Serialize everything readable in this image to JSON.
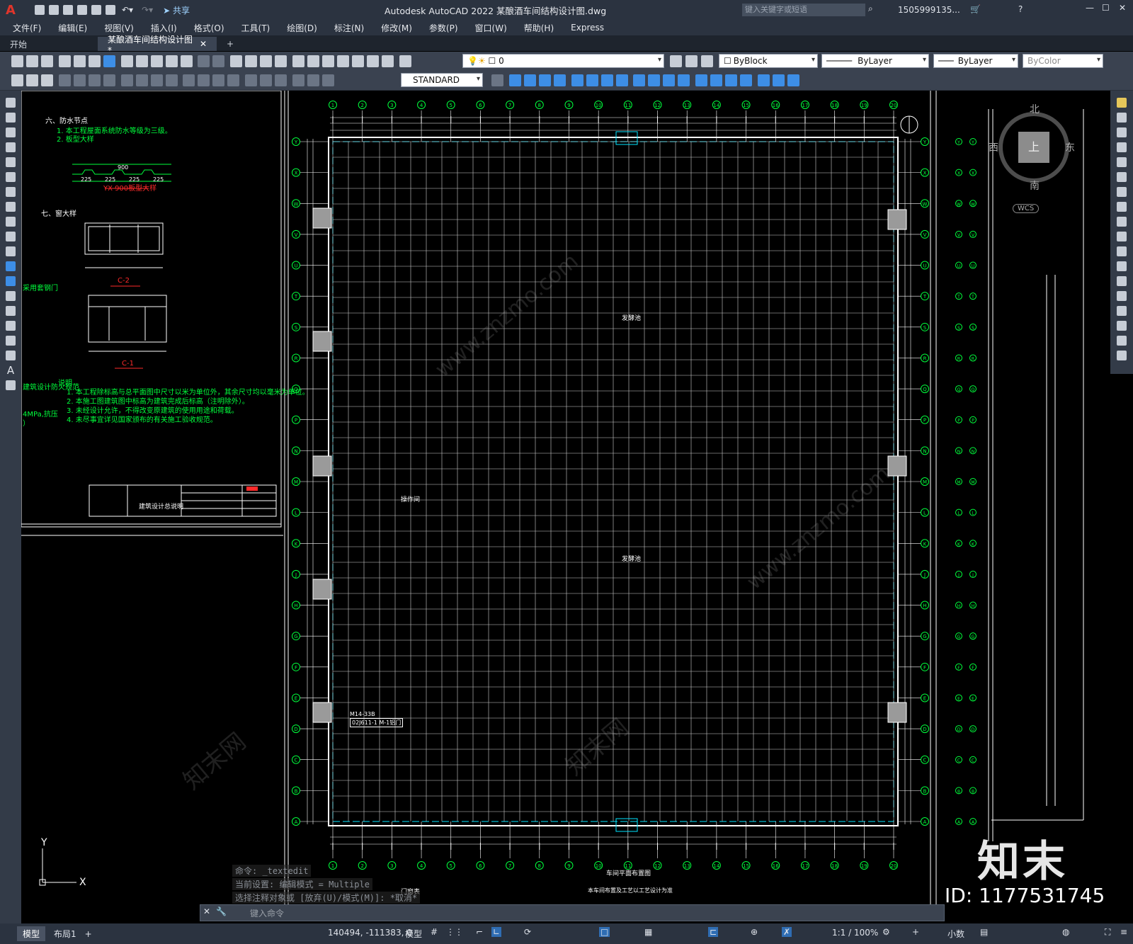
{
  "app": {
    "title": "Autodesk AutoCAD 2022    某酿酒车间结构设计图.dwg",
    "share_label": "共享",
    "search_placeholder": "键入关键字或短语",
    "user": "1505999135...",
    "logo": "A"
  },
  "menu": [
    "文件(F)",
    "编辑(E)",
    "视图(V)",
    "插入(I)",
    "格式(O)",
    "工具(T)",
    "绘图(D)",
    "标注(N)",
    "修改(M)",
    "参数(P)",
    "窗口(W)",
    "帮助(H)",
    "Express"
  ],
  "tabs": [
    {
      "label": "开始",
      "active": false
    },
    {
      "label": "某酿酒车间结构设计图*",
      "active": true
    }
  ],
  "toolbar": {
    "layer": "0",
    "color": "ByBlock",
    "linetype": "ByLayer",
    "lineweight": "ByLayer",
    "plotstyle": "ByColor",
    "textstyle": "STANDARD"
  },
  "drawing_notes": {
    "sec6_title": "六、防水节点",
    "sec6_lines": [
      "1. 本工程屋面系统防水等级为三级。",
      "2. 板型大样"
    ],
    "panel_caption": "YX-900板型大样",
    "panel_dims": [
      "900",
      "225",
      "225",
      "225",
      "225"
    ],
    "sec7_title": "七、窗大样",
    "window_labels": [
      "C-2",
      "C-1"
    ],
    "side_note": "采用套钢门",
    "notes_title": "说明",
    "notes_lines": [
      "1. 本工程除标高与总平面图中尺寸以米为单位外，其余尺寸均以毫米为单位。",
      "2. 本施工图建筑图中标高为建筑完成后标高（注明除外）。",
      "3. 未经设计允许，不得改变原建筑的使用用途和荷载。",
      "4. 未尽事宜详见国家颁布的有关施工验收规范。"
    ],
    "left_fragments": [
      "建筑设计防火规范",
      "4MPa,抗压",
      "）"
    ],
    "titleblock": "建筑设计总说明",
    "door_labels": [
      "M14-33B",
      "02J611-1 M-1铝门"
    ],
    "room_labels": [
      "发酵池",
      "操作间",
      "发酵池"
    ],
    "plan_title": "车间平面布置图",
    "plan_subtitle": "本车间布置及工艺以工艺设计为准",
    "bottom_caption": "门窗表"
  },
  "grid_cols": [
    "1",
    "2",
    "3",
    "4",
    "5",
    "6",
    "7",
    "8",
    "9",
    "10",
    "11",
    "12",
    "13",
    "14",
    "15",
    "16",
    "17",
    "18",
    "19",
    "20"
  ],
  "grid_rows": [
    "Y",
    "X",
    "W",
    "V",
    "U",
    "T",
    "S",
    "R",
    "Q",
    "P",
    "N",
    "M",
    "L",
    "K",
    "J",
    "H",
    "G",
    "F",
    "E",
    "D",
    "C",
    "B",
    "A"
  ],
  "viewcube": {
    "north": "北",
    "south": "南",
    "east": "东",
    "west": "西",
    "face": "上",
    "wcs": "WCS"
  },
  "command": {
    "history": [
      "命令: _textedit",
      "当前设置: 编辑模式 = Multiple",
      "选择注释对象或 [放弃(U)/模式(M)]: *取消*"
    ],
    "placeholder": "键入命令"
  },
  "layout_tabs": [
    "模型",
    "布局1"
  ],
  "status": {
    "coords": "140494, -111383, 0",
    "space": "模型",
    "scale": "1:1 / 100%",
    "units": "小数"
  },
  "watermark": {
    "brand": "知末",
    "id": "ID: 1177531745",
    "url": "www.znzmo.com",
    "name": "知末网"
  },
  "colors": {
    "accent": "#00ff3c",
    "chrome": "#2b3340",
    "cyan": "#00e5ff",
    "red": "#ff2a2a"
  }
}
